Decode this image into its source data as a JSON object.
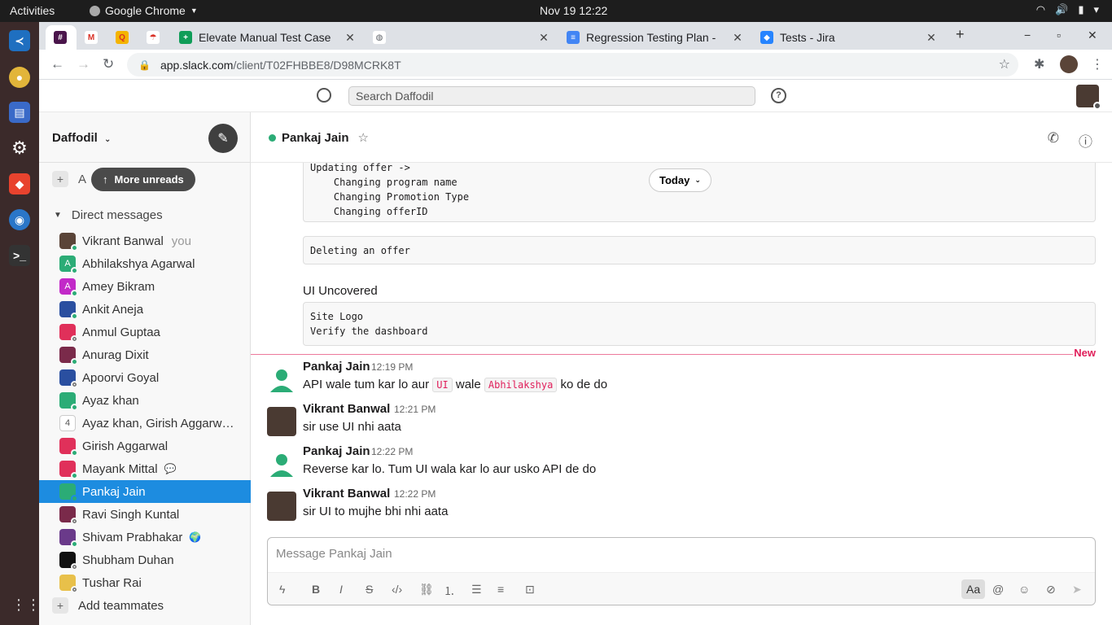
{
  "system": {
    "activities": "Activities",
    "app_menu": "Google Chrome",
    "clock": "Nov 19  12:22"
  },
  "browser": {
    "tabs": [
      {
        "title": "",
        "icon": "slack-icon"
      },
      {
        "title": "",
        "icon": "gmail-icon"
      },
      {
        "title": "",
        "icon": "docs-red-icon"
      },
      {
        "title": "",
        "icon": "umbrella-icon"
      },
      {
        "title": "Elevate Manual Test Case",
        "icon": "sheets-icon"
      },
      {
        "title": "",
        "icon": "globe-icon"
      },
      {
        "title": "Regression Testing Plan -",
        "icon": "docs-icon"
      },
      {
        "title": "Tests - Jira",
        "icon": "jira-icon"
      }
    ],
    "url_host": "app.slack.com",
    "url_path": "/client/T02FHBBE8/D98MCRK8T"
  },
  "slack": {
    "search_placeholder": "Search Daffodil",
    "workspace": "Daffodil",
    "add_label": "A",
    "more_unreads": "More unreads",
    "dm_header": "Direct messages",
    "you_label": "you",
    "dms": [
      {
        "name": "Vikrant Banwal",
        "color": "#5a4438",
        "status": "online",
        "you": true
      },
      {
        "name": "Abhilakshya Agarwal",
        "color": "#2bac76",
        "status": "online",
        "initial": "A"
      },
      {
        "name": "Amey Bikram",
        "color": "#c229c8",
        "status": "online",
        "initial": "A"
      },
      {
        "name": "Ankit Aneja",
        "color": "#2a4fa0",
        "status": "online"
      },
      {
        "name": "Anmul Guptaa",
        "color": "#e0305a",
        "status": "away"
      },
      {
        "name": "Anurag Dixit",
        "color": "#7a2a4a",
        "status": "online"
      },
      {
        "name": "Apoorvi Goyal",
        "color": "#2a4fa0",
        "status": "away"
      },
      {
        "name": "Ayaz khan",
        "color": "#2bac76",
        "status": "online"
      },
      {
        "name": "Ayaz khan, Girish Aggarwal...",
        "color": "#2bac76",
        "status": "count",
        "count": "4"
      },
      {
        "name": "Girish Aggarwal",
        "color": "#e0305a",
        "status": "online"
      },
      {
        "name": "Mayank Mittal",
        "color": "#e0305a",
        "status": "online",
        "extra": "💬"
      },
      {
        "name": "Pankaj Jain",
        "color": "#2bac76",
        "status": "online",
        "selected": true
      },
      {
        "name": "Ravi Singh Kuntal",
        "color": "#7a2a4a",
        "status": "away"
      },
      {
        "name": "Shivam Prabhakar",
        "color": "#6a3a8a",
        "status": "online",
        "extra": "🌍"
      },
      {
        "name": "Shubham Duhan",
        "color": "#111",
        "status": "away"
      },
      {
        "name": "Tushar Rai",
        "color": "#e8c04a",
        "status": "away"
      }
    ],
    "add_teammates": "Add teammates",
    "channel_name": "Pankaj Jain",
    "today_label": "Today",
    "code_block_1": "Updating offer ->\n    Changing program name\n    Changing Promotion Type\n    Changing offerID",
    "code_block_2": "Deleting an offer",
    "ui_uncovered": "UI Uncovered",
    "code_block_3": "Site Logo\nVerify the dashboard",
    "new_label": "New",
    "messages": [
      {
        "author": "Pankaj Jain",
        "time": "12:19 PM",
        "text_a": "API wale tum kar lo aur ",
        "code_a": "UI",
        "text_b": " wale ",
        "code_b": "Abhilakshya",
        "text_c": " ko de do"
      },
      {
        "author": "Vikrant Banwal",
        "time": "12:21 PM",
        "text": "sir use UI nhi aata"
      },
      {
        "author": "Pankaj Jain",
        "time": "12:22 PM",
        "text": "Reverse kar lo. Tum UI wala kar lo aur usko API de do"
      },
      {
        "author": "Vikrant Banwal",
        "time": "12:22 PM",
        "text": "sir UI to mujhe bhi nhi aata"
      }
    ],
    "composer_placeholder": "Message Pankaj Jain",
    "composer_format_label": "Aa"
  }
}
